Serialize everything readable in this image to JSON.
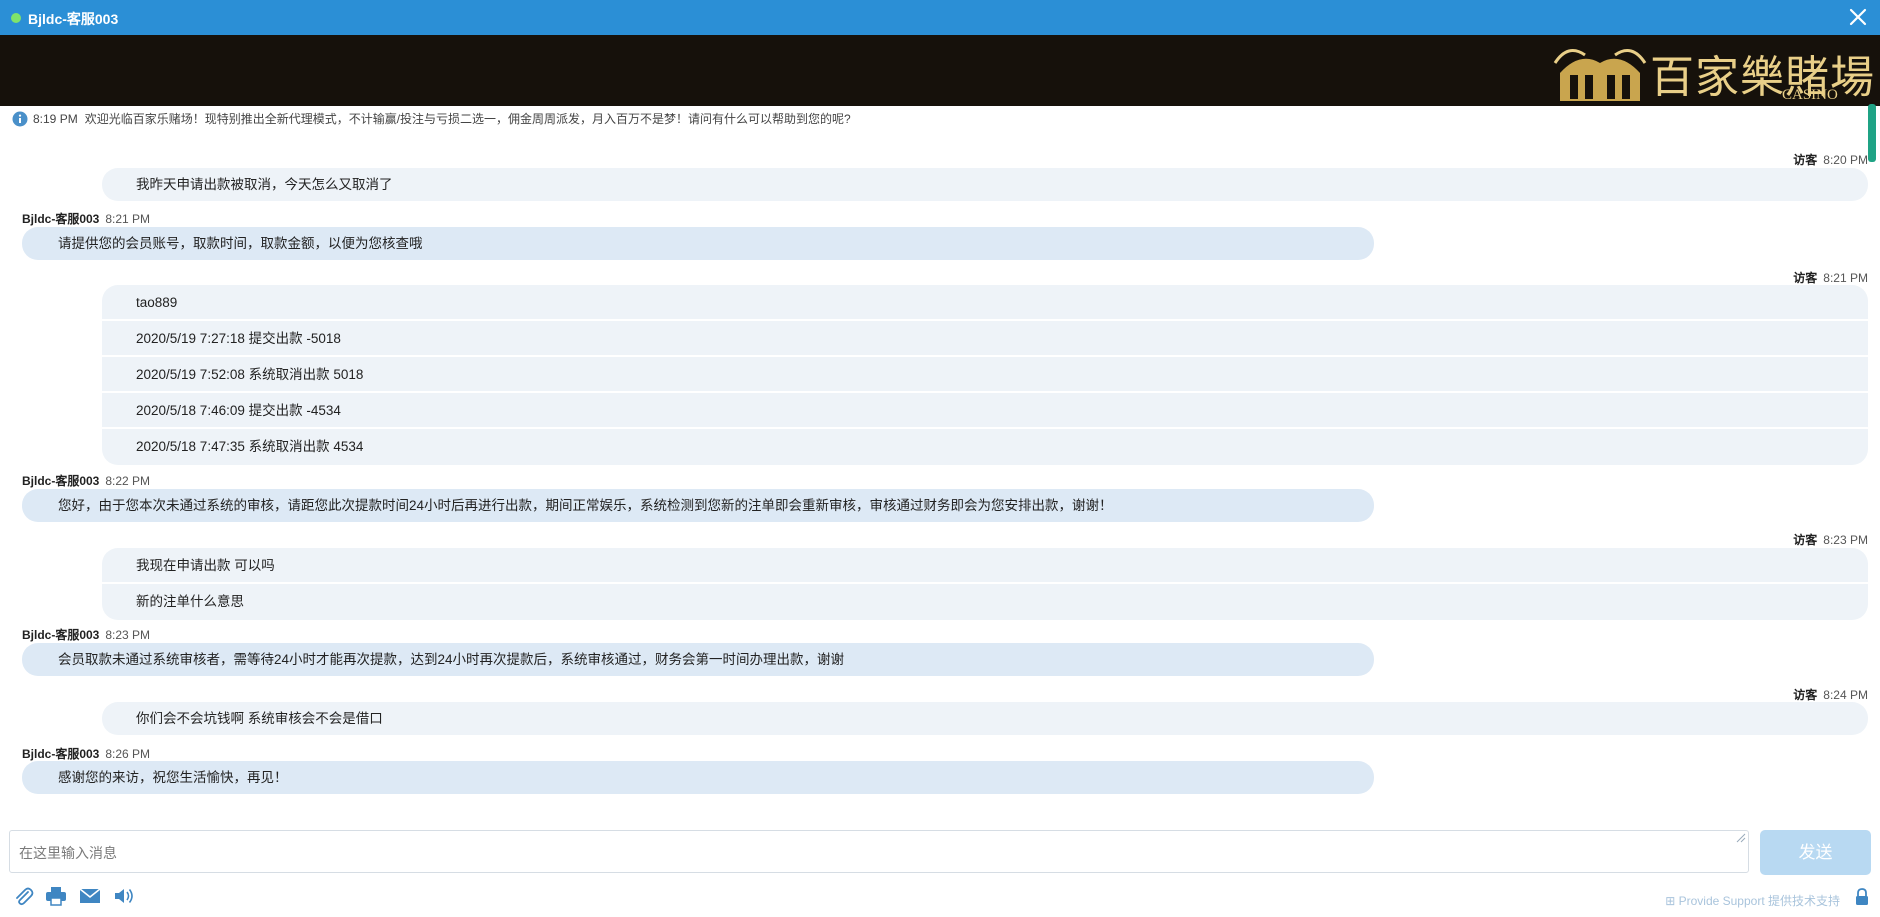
{
  "window": {
    "title": "Bjldc-客服003",
    "status": "online"
  },
  "banner": {
    "logo_title": "百家樂賭場",
    "logo_sub": "CASINO"
  },
  "system_message": {
    "time": "8:19 PM",
    "text": "欢迎光临百家乐赌场！现特别推出全新代理模式，不计输赢/投注与亏损二选一，佣金周周派发，月入百万不是梦！请问有什么可以帮助到您的呢?"
  },
  "conversation": [
    {
      "sender": "访客",
      "time": "8:20 PM",
      "lines": [
        "我昨天申请出款被取消，今天怎么又取消了"
      ]
    },
    {
      "sender": "Bjldc-客服003",
      "time": "8:21 PM",
      "lines": [
        "请提供您的会员账号，取款时间，取款金额，以便为您核查哦"
      ]
    },
    {
      "sender": "访客",
      "time": "8:21 PM",
      "lines": [
        "tao889",
        "2020/5/19 7:27:18 提交出款 -5018",
        "2020/5/19 7:52:08 系统取消出款 5018",
        "2020/5/18 7:46:09 提交出款 -4534",
        "2020/5/18 7:47:35 系统取消出款 4534"
      ]
    },
    {
      "sender": "Bjldc-客服003",
      "time": "8:22 PM",
      "lines": [
        "您好，由于您本次未通过系统的审核，请距您此次提款时间24小时后再进行出款，期间正常娱乐，系统检测到您新的注单即会重新审核，审核通过财务即会为您安排出款，谢谢！"
      ]
    },
    {
      "sender": "访客",
      "time": "8:23 PM",
      "lines": [
        "我现在申请出款 可以吗",
        "新的注单什么意思"
      ]
    },
    {
      "sender": "Bjldc-客服003",
      "time": "8:23 PM",
      "lines": [
        "会员取款未通过系统审核者，需等待24小时才能再次提款，达到24小时再次提款后，系统审核通过，财务会第一时间办理出款，谢谢"
      ]
    },
    {
      "sender": "访客",
      "time": "8:24 PM",
      "lines": [
        "你们会不会坑钱啊 系统审核会不会是借口"
      ]
    },
    {
      "sender": "Bjldc-客服003",
      "time": "8:26 PM",
      "lines": [
        "感谢您的来访，祝您生活愉快，再见！"
      ]
    }
  ],
  "composer": {
    "placeholder": "在这里输入消息",
    "send_label": "发送"
  },
  "toolbar": {
    "icons": [
      "paperclip-icon",
      "printer-icon",
      "envelope-icon",
      "speaker-icon"
    ]
  },
  "footer": {
    "powered_by": "Provide Support 提供技术支持"
  },
  "colors": {
    "titlebar": "#2b8fd6",
    "banner": "#16110b",
    "agent_bubble": "#dde9f5",
    "visitor_bubble": "#eef3f8",
    "send_button": "#b8d9f2",
    "online_dot": "#7fe36b"
  }
}
